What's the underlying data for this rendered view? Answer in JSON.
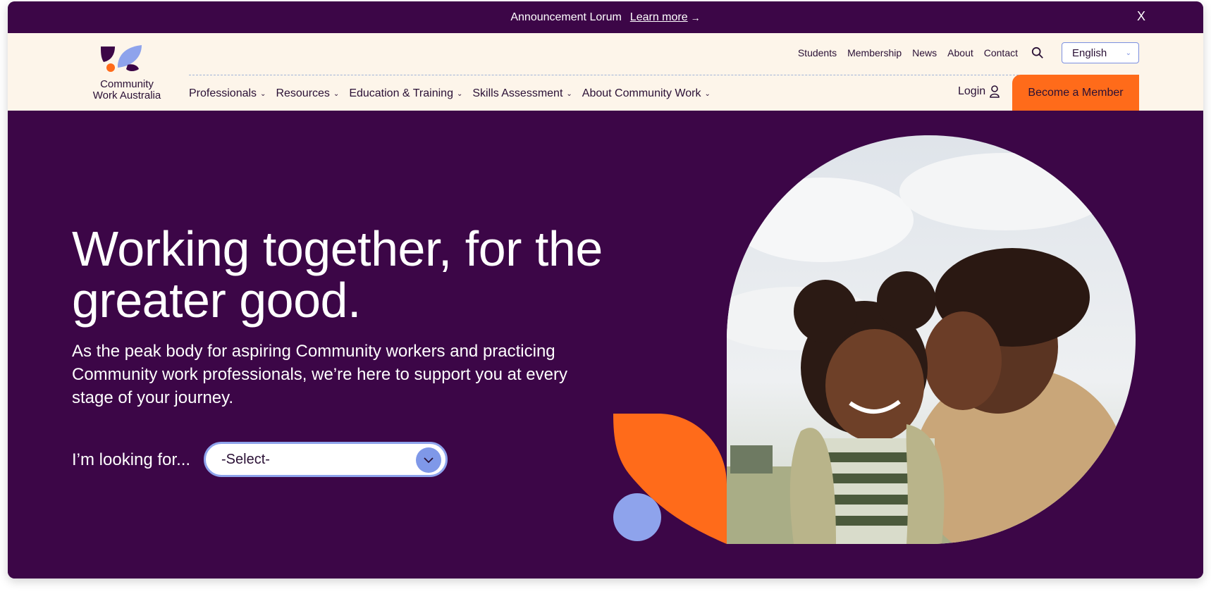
{
  "announcement": {
    "text": "Announcement Lorum",
    "link_label": "Learn more",
    "arrow": "→",
    "close_label": "X"
  },
  "brand": {
    "name_line1": "Community",
    "name_line2": "Work Australia"
  },
  "utility_nav": {
    "items": [
      "Students",
      "Membership",
      "News",
      "About",
      "Contact"
    ],
    "language": "English"
  },
  "main_nav": {
    "items": [
      "Professionals",
      "Resources",
      "Education & Training",
      "Skills Assessment",
      "About Community Work"
    ]
  },
  "header_actions": {
    "login_label": "Login",
    "member_label": "Become a Member"
  },
  "hero": {
    "headline": "Working together, for the greater good.",
    "subtext": "As the peak body for aspiring Community workers and practicing Community work professionals, we’re here to support you at every stage of your journey.",
    "looking_label": "I’m looking for...",
    "select_value": "-Select-"
  },
  "colors": {
    "brand_purple": "#3c0647",
    "cream": "#fdf5ea",
    "accent_orange": "#ff6b1a",
    "accent_blue": "#7f98e8"
  },
  "icons": {
    "search": "search-icon",
    "user": "user-icon",
    "chevron": "chevron-down-icon",
    "arrow": "arrow-right-icon"
  }
}
